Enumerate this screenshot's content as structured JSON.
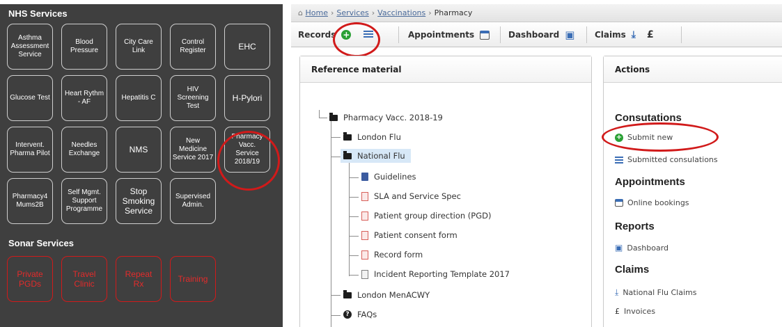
{
  "left_panel": {
    "nhs_heading": "NHS Services",
    "nhs_tiles": [
      {
        "label": "Asthma\nAssessment\nService"
      },
      {
        "label": "Blood\nPressure"
      },
      {
        "label": "City Care\nLink"
      },
      {
        "label": "Control\nRegister"
      },
      {
        "label": "EHC"
      },
      {
        "label": "Glucose Test"
      },
      {
        "label": "Heart Rythm\n- AF"
      },
      {
        "label": "Hepatitis C"
      },
      {
        "label": "HIV\nScreening\nTest"
      },
      {
        "label": "H-Pylori"
      },
      {
        "label": "Intervent.\nPharma Pilot"
      },
      {
        "label": "Needles\nExchange"
      },
      {
        "label": "NMS"
      },
      {
        "label": "New\nMedicine\nService 2017"
      },
      {
        "label": "Pharmacy\nVacc.\nService\n2018/19"
      },
      {
        "label": "Pharmacy4\nMums2B"
      },
      {
        "label": "Self Mgmt.\nSupport\nProgramme"
      },
      {
        "label": "Stop\nSmoking\nService"
      },
      {
        "label": "Supervised\nAdmin."
      }
    ],
    "sonar_heading": "Sonar Services",
    "sonar_tiles": [
      {
        "label": "Private\nPGDs"
      },
      {
        "label": "Travel\nClinic"
      },
      {
        "label": "Repeat\nRx"
      },
      {
        "label": "Training"
      }
    ]
  },
  "breadcrumb": {
    "home": "Home",
    "services": "Services",
    "vaccinations": "Vaccinations",
    "current": "Pharmacy",
    "separator": "›"
  },
  "toolbar": {
    "records": "Records",
    "appointments": "Appointments",
    "dashboard": "Dashboard",
    "claims": "Claims",
    "pound_symbol": "£"
  },
  "reference": {
    "title": "Reference material",
    "root": "Pharmacy Vacc. 2018-19",
    "london_flu": "London Flu",
    "national_flu": "National Flu",
    "guidelines": "Guidelines",
    "sla": "SLA and Service Spec",
    "pgd": "Patient group direction (PGD)",
    "consent": "Patient consent form",
    "record_form": "Record form",
    "incident": "Incident Reporting Template 2017",
    "london_menacwy": "London MenACWY",
    "faqs": "FAQs"
  },
  "actions": {
    "title": "Actions",
    "consultations_heading": "Consutations",
    "submit_new": "Submit new",
    "submitted": "Submitted consulations",
    "appointments_heading": "Appointments",
    "online_bookings": "Online bookings",
    "reports_heading": "Reports",
    "dashboard_link": "Dashboard",
    "claims_heading": "Claims",
    "national_flu_claims": "National Flu Claims",
    "invoices": "Invoices"
  },
  "colors": {
    "panel_bg": "#3f3f3f",
    "tile_border": "#cfcfcf",
    "sonar_red": "#e32b2b",
    "annotation_ring": "#d11a1a",
    "link_blue": "#3a6db5",
    "selected_row": "#d7e8f7"
  },
  "icons": {
    "records_add": "plus-circle-icon",
    "records_list": "list-icon",
    "appointments": "calendar-icon",
    "dashboard": "dashboard-icon",
    "claims": "download-icon",
    "invoices": "pound-icon",
    "folder": "folder-icon",
    "guidelines": "book-icon",
    "pdf": "pdf-file-icon",
    "document": "document-icon",
    "faqs": "help-icon"
  }
}
